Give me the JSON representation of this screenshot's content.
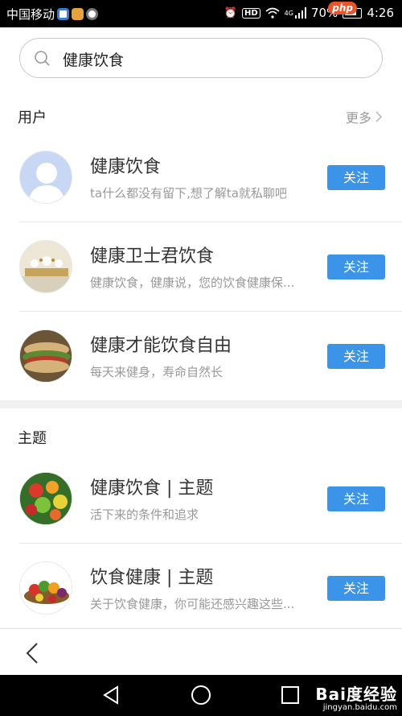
{
  "status_bar": {
    "carrier": "中国移动",
    "battery": "70%",
    "time": "4:26",
    "hd": "HD",
    "network": "4G",
    "php_badge": "php"
  },
  "search": {
    "value": "健康饮食"
  },
  "users_section": {
    "title": "用户",
    "more": "更多",
    "items": [
      {
        "name": "健康饮食",
        "desc": "ta什么都没有留下,想了解ta就私聊吧",
        "follow": "关注",
        "avatar": "default-person-avatar"
      },
      {
        "name": "健康卫士君饮食",
        "desc": "健康饮食，健康说，您的饮食健康保...",
        "follow": "关注",
        "avatar": "food-table-avatar"
      },
      {
        "name": "健康才能饮食自由",
        "desc": "每天来健身，寿命自然长",
        "follow": "关注",
        "avatar": "sandwich-avatar"
      }
    ]
  },
  "topics_section": {
    "title": "主题",
    "items": [
      {
        "name": "健康饮食 | 主题",
        "desc": "活下来的条件和追求",
        "follow": "关注",
        "avatar": "fruits-avatar"
      },
      {
        "name": "饮食健康 | 主题",
        "desc": "关于饮食健康，你可能还感兴趣这些...",
        "follow": "关注",
        "avatar": "vegetables-avatar"
      }
    ]
  },
  "watermark": {
    "main": "Bai度经验",
    "sub": "jingyan.baidu.com"
  },
  "colors": {
    "accent": "#3b94e8",
    "text": "#333333",
    "muted": "#999999"
  }
}
